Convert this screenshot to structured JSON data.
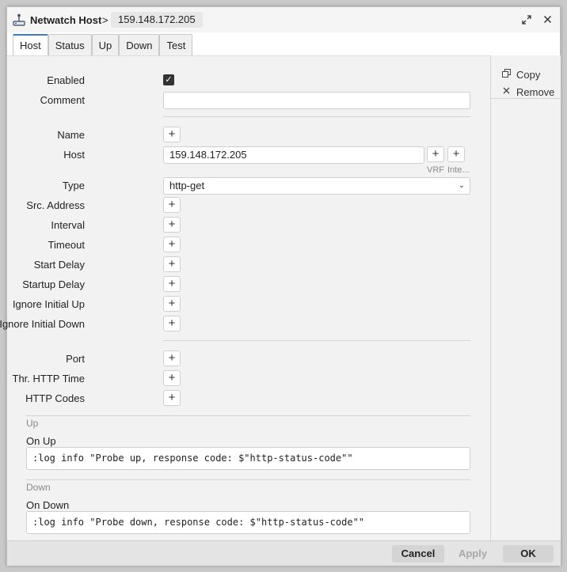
{
  "window": {
    "title": "Netwatch Host",
    "breadcrumb_sep": ">",
    "breadcrumb_host": "159.148.172.205",
    "restore_icon": "expand-icon",
    "close_icon": "close-icon"
  },
  "tabs": [
    {
      "label": "Host",
      "active": true
    },
    {
      "label": "Status"
    },
    {
      "label": "Up"
    },
    {
      "label": "Down"
    },
    {
      "label": "Test"
    }
  ],
  "sidebar": {
    "copy_label": "Copy",
    "remove_label": "Remove"
  },
  "form": {
    "enabled_label": "Enabled",
    "enabled_checked": true,
    "comment_label": "Comment",
    "comment_value": "",
    "name_label": "Name",
    "host_label": "Host",
    "host_value": "159.148.172.205",
    "vrf_label": "VRF",
    "interface_label": "Inte...",
    "type_label": "Type",
    "type_value": "http-get",
    "src_address_label": "Src. Address",
    "interval_label": "Interval",
    "timeout_label": "Timeout",
    "start_delay_label": "Start Delay",
    "startup_delay_label": "Startup Delay",
    "ignore_initial_up_label": "Ignore Initial Up",
    "ignore_initial_down_label": "Ignore Initial Down",
    "port_label": "Port",
    "thr_http_time_label": "Thr. HTTP Time",
    "http_codes_label": "HTTP Codes"
  },
  "up_section": {
    "title": "Up",
    "on_up_label": "On Up",
    "on_up_value": ":log info \"Probe up, response code: $\"http-status-code\"\""
  },
  "down_section": {
    "title": "Down",
    "on_down_label": "On Down",
    "on_down_value": ":log info \"Probe down, response code: $\"http-status-code\"\""
  },
  "footer": {
    "cancel_label": "Cancel",
    "apply_label": "Apply",
    "ok_label": "OK"
  },
  "colors": {
    "accent": "#3b7bd2",
    "panel": "#f2f2f2",
    "footer": "#e4e4e4"
  }
}
